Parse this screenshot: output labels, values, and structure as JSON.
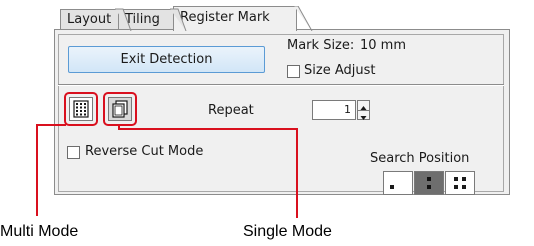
{
  "tabs": [
    {
      "label": "Layout",
      "active": false
    },
    {
      "label": "Tiling",
      "active": false
    },
    {
      "label": "Register Mark",
      "active": true
    }
  ],
  "buttons": {
    "exit_detection": "Exit Detection"
  },
  "mark_size": {
    "label": "Mark Size:",
    "value": "10 mm"
  },
  "size_adjust": {
    "label": "Size Adjust",
    "checked": false
  },
  "repeat": {
    "label": "Repeat",
    "value": "1"
  },
  "reverse_cut_mode": {
    "label": "Reverse Cut Mode",
    "checked": false
  },
  "search_position": {
    "label": "Search Position",
    "options": [
      "single-dot",
      "two-dots-vertical",
      "four-dots"
    ],
    "selected_index": 1
  },
  "callouts": {
    "multi_mode": "Multi Mode",
    "single_mode": "Single Mode"
  },
  "colors": {
    "highlight": "#d9101e",
    "button_border": "#5b9bd5",
    "panel_bg": "#f0f0f0"
  }
}
